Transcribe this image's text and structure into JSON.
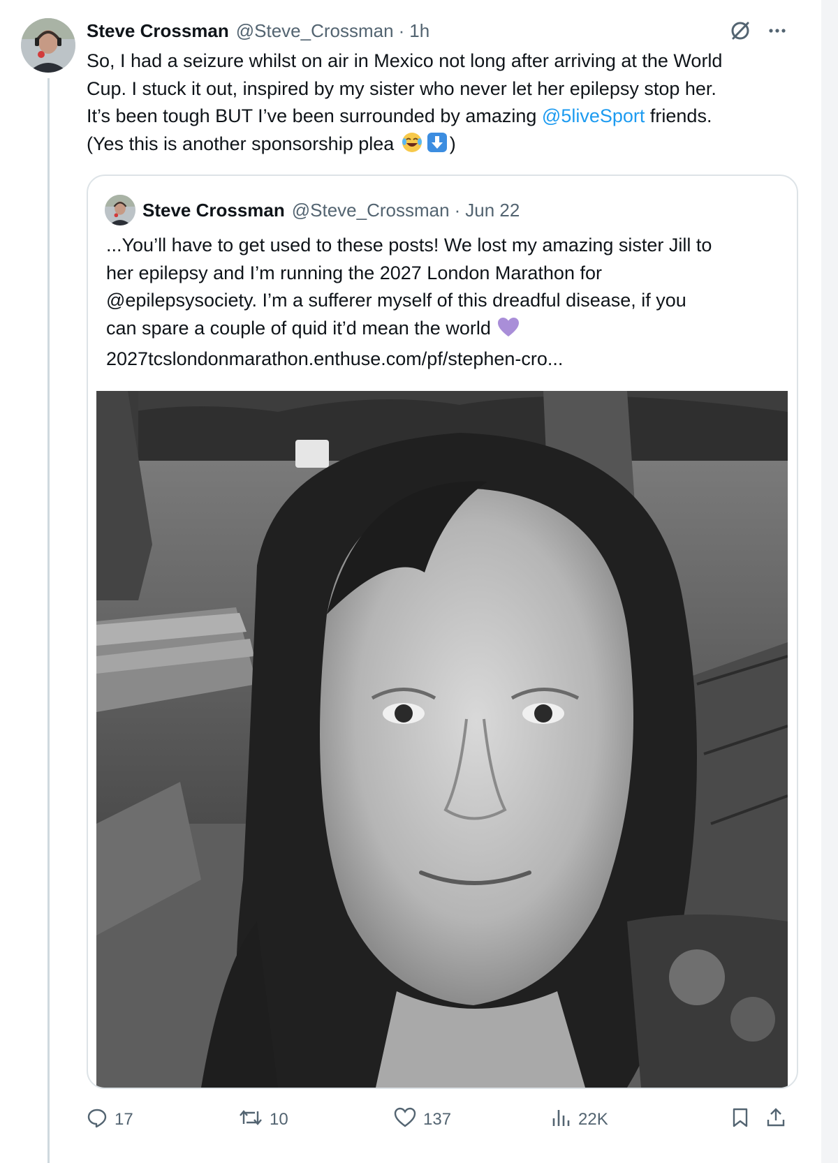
{
  "post": {
    "author_name": "Steve Crossman",
    "author_handle": "@Steve_Crossman",
    "separator": "·",
    "time": "1h",
    "text": {
      "line1": "So, I had a seizure whilst on air in Mexico not long after arriving at the World",
      "line2": "Cup. I stuck it out, inspired by my sister who never let her epilepsy stop her.",
      "line3_before": "It’s been tough BUT I’ve been surrounded by amazing ",
      "line3_mention": "@5liveSport",
      "line3_after": " friends.",
      "line4_before": "(Yes this is another sponsorship plea ",
      "emoji_laugh": "😂",
      "emoji_down_arrow": "⬇",
      "line4_after": ")"
    },
    "icons": {
      "grok": "grok-icon",
      "more": "more-icon"
    }
  },
  "quote": {
    "author_name": "Steve Crossman",
    "author_handle": "@Steve_Crossman",
    "separator": "·",
    "date": "Jun 22",
    "text": {
      "line1": "...You’ll have to get used to these posts! We lost my amazing sister Jill to",
      "line2": "her epilepsy and I’m running the 2027 London Marathon for",
      "line3": "@epilepsysociety. I’m a sufferer myself of this dreadful disease, if you",
      "line4_before": "can spare a couple of quid it’d mean the world ",
      "emoji_heart": "💜",
      "line5": "2027tcslondonmarathon.enthuse.com/pf/stephen-cro..."
    }
  },
  "actions": {
    "replies": "17",
    "reposts": "10",
    "likes": "137",
    "views": "22K"
  },
  "colors": {
    "text": "#0f1419",
    "muted": "#536471",
    "link": "#1d9bf0",
    "border": "#dde3e7",
    "heart_emoji": "#a98ed8"
  }
}
